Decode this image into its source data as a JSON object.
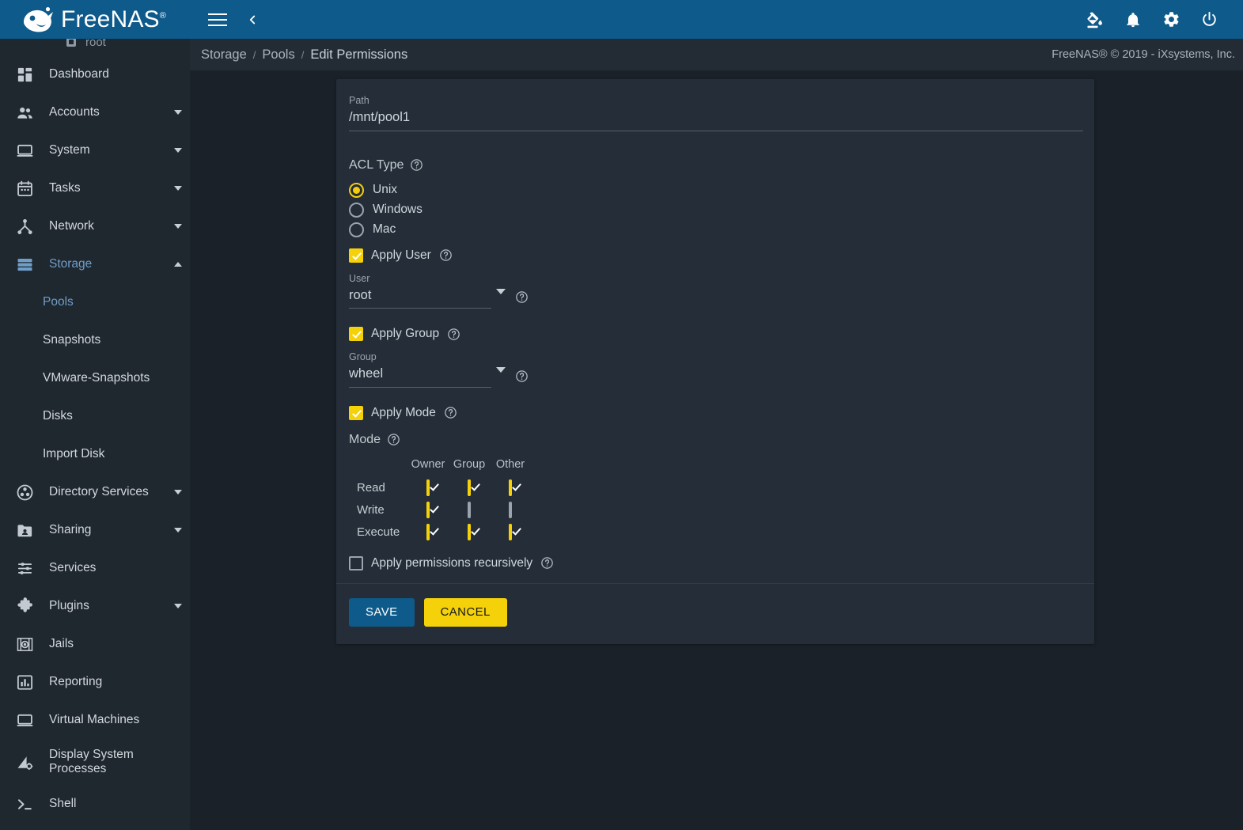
{
  "app": {
    "name": "FreeNAS",
    "logo_sup": "®",
    "copyright": "FreeNAS® © 2019 - iXsystems, Inc."
  },
  "topbar": {
    "menu_toggle": "hamburger-icon",
    "collapse": "chevron-left-icon",
    "icons": [
      {
        "name": "theme-picker-icon",
        "label": "Change Theme"
      },
      {
        "name": "notifications-icon",
        "label": "Alerts"
      },
      {
        "name": "settings-icon",
        "label": "Settings"
      },
      {
        "name": "power-icon",
        "label": "Power"
      }
    ]
  },
  "sidebar": {
    "user": "root",
    "items": [
      {
        "label": "Dashboard",
        "icon": "dashboard-icon",
        "expandable": false,
        "active": false
      },
      {
        "label": "Accounts",
        "icon": "accounts-icon",
        "expandable": true,
        "active": false
      },
      {
        "label": "System",
        "icon": "system-icon",
        "expandable": true,
        "active": false
      },
      {
        "label": "Tasks",
        "icon": "tasks-icon",
        "expandable": true,
        "active": false
      },
      {
        "label": "Network",
        "icon": "network-icon",
        "expandable": true,
        "active": false
      },
      {
        "label": "Storage",
        "icon": "storage-icon",
        "expandable": true,
        "active": true,
        "expanded": true
      },
      {
        "label": "Directory Services",
        "icon": "directory-services-icon",
        "expandable": true,
        "active": false
      },
      {
        "label": "Sharing",
        "icon": "sharing-icon",
        "expandable": true,
        "active": false
      },
      {
        "label": "Services",
        "icon": "services-icon",
        "expandable": false,
        "active": false
      },
      {
        "label": "Plugins",
        "icon": "plugins-icon",
        "expandable": true,
        "active": false
      },
      {
        "label": "Jails",
        "icon": "jails-icon",
        "expandable": false,
        "active": false
      },
      {
        "label": "Reporting",
        "icon": "reporting-icon",
        "expandable": false,
        "active": false
      },
      {
        "label": "Virtual Machines",
        "icon": "virtual-machines-icon",
        "expandable": false,
        "active": false
      },
      {
        "label": "Display System Processes",
        "icon": "display-processes-icon",
        "expandable": false,
        "active": false
      },
      {
        "label": "Shell",
        "icon": "shell-icon",
        "expandable": false,
        "active": false
      }
    ],
    "storage_children": [
      {
        "label": "Pools",
        "active": true
      },
      {
        "label": "Snapshots",
        "active": false
      },
      {
        "label": "VMware-Snapshots",
        "active": false
      },
      {
        "label": "Disks",
        "active": false
      },
      {
        "label": "Import Disk",
        "active": false
      }
    ]
  },
  "breadcrumb": {
    "items": [
      "Storage",
      "Pools",
      "Edit Permissions"
    ],
    "separator": "/"
  },
  "form": {
    "path": {
      "label": "Path",
      "value": "/mnt/pool1"
    },
    "acl_type": {
      "label": "ACL Type",
      "selected": "Unix",
      "options": [
        "Unix",
        "Windows",
        "Mac"
      ]
    },
    "apply_user": {
      "label": "Apply User",
      "checked": true
    },
    "user": {
      "label": "User",
      "value": "root"
    },
    "apply_group": {
      "label": "Apply Group",
      "checked": true
    },
    "group": {
      "label": "Group",
      "value": "wheel"
    },
    "apply_mode": {
      "label": "Apply Mode",
      "checked": true
    },
    "mode": {
      "label": "Mode",
      "columns": [
        "Owner",
        "Group",
        "Other"
      ],
      "rows": [
        {
          "label": "Read",
          "values": [
            true,
            true,
            true
          ]
        },
        {
          "label": "Write",
          "values": [
            true,
            false,
            false
          ]
        },
        {
          "label": "Execute",
          "values": [
            true,
            true,
            true
          ]
        }
      ]
    },
    "recursive": {
      "label": "Apply permissions recursively",
      "checked": false
    },
    "help_icon": "help-circle-icon"
  },
  "actions": {
    "save": "SAVE",
    "cancel": "CANCEL"
  },
  "colors": {
    "brand_blue": "#0e5a8a",
    "accent_yellow": "#f5d10a",
    "sidebar_bg": "#1f272f",
    "card_bg": "#252e38",
    "page_bg": "#1a2128",
    "active_link": "#6f9ec9"
  }
}
